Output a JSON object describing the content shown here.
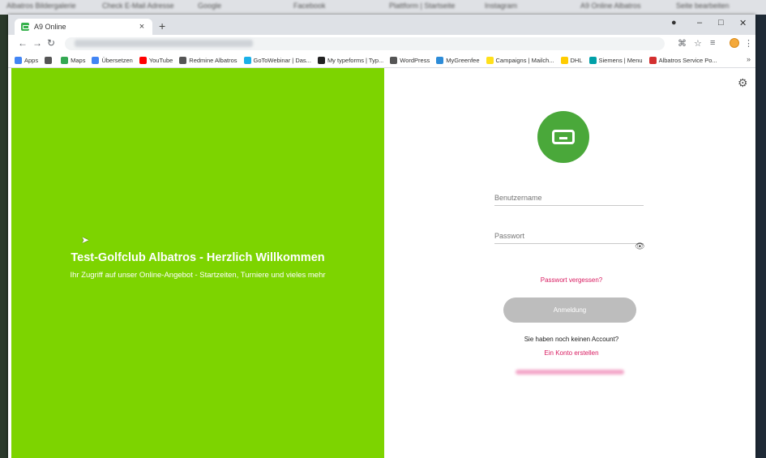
{
  "background": {
    "tabs": [
      "Albatros Bildergalerie",
      "Check E-Mail Adresse",
      "Google",
      "Facebook",
      "Plattform | Startseite",
      "Instagram",
      "A9 Online Albatros",
      "Seite bearbeiten"
    ]
  },
  "browser": {
    "tab_title": "A9 Online",
    "new_tab": "+",
    "tab_close": "×",
    "window_controls": {
      "minimize": "–",
      "maximize": "□",
      "close": "✕"
    },
    "bookmarks_more": "»",
    "bookmarks": [
      {
        "label": "Apps",
        "color": "#4285f4"
      },
      {
        "label": "",
        "color": "#555555"
      },
      {
        "label": "Maps",
        "color": "#34a853"
      },
      {
        "label": "Übersetzen",
        "color": "#4285f4"
      },
      {
        "label": "YouTube",
        "color": "#ff0000"
      },
      {
        "label": "Redmine Albatros",
        "color": "#555555"
      },
      {
        "label": "GoToWebinar | Das...",
        "color": "#1ab0e8"
      },
      {
        "label": "My typeforms | Typ...",
        "color": "#222222"
      },
      {
        "label": "WordPress",
        "color": "#555555"
      },
      {
        "label": "MyGreenfee",
        "color": "#2d8cd8"
      },
      {
        "label": "Campaigns | Mailch...",
        "color": "#ffe01b"
      },
      {
        "label": "DHL",
        "color": "#ffcc00"
      },
      {
        "label": "Siemens | Menu",
        "color": "#00a0a8"
      },
      {
        "label": "Albatros Service Po...",
        "color": "#d32f2f"
      }
    ]
  },
  "welcome": {
    "title": "Test-Golfclub Albatros - Herzlich Willkommen",
    "subtitle": "Ihr Zugriff auf unser Online-Angebot - Startzeiten, Turniere und vieles mehr"
  },
  "login": {
    "username_placeholder": "Benutzername",
    "password_placeholder": "Passwort",
    "forgot_password": "Passwort vergessen?",
    "submit_label": "Anmeldung",
    "no_account_text": "Sie haben noch keinen Account?",
    "create_account": "Ein Konto erstellen"
  },
  "colors": {
    "brand_green": "#7dd400",
    "logo_green": "#4aa83a",
    "link_pink": "#d81b60",
    "button_gray": "#bdbdbd"
  }
}
